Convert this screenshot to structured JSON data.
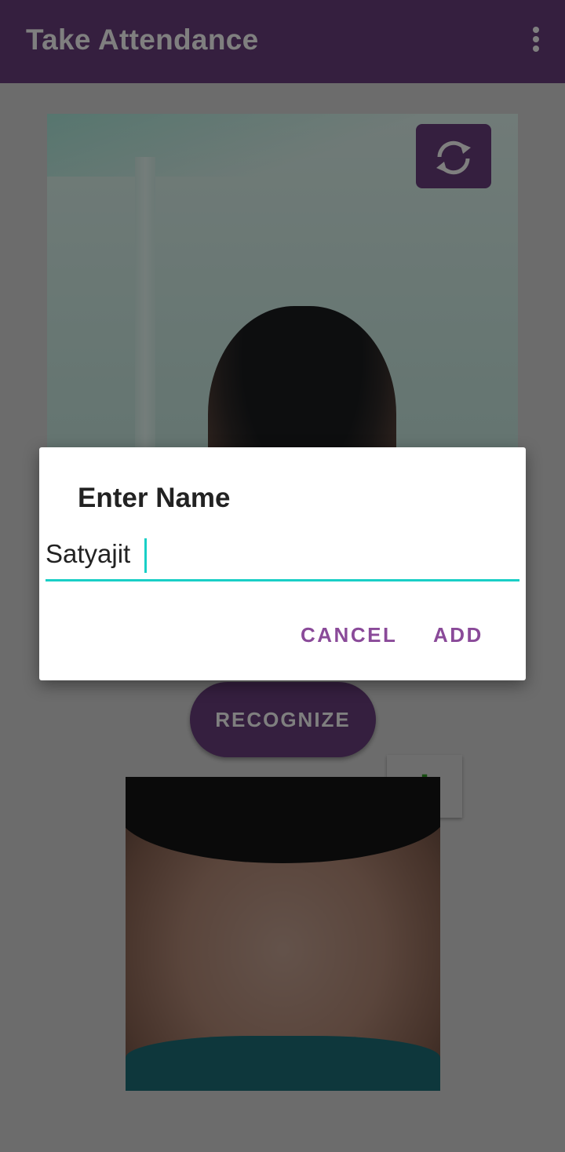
{
  "app_bar": {
    "title": "Take Attendance",
    "overflow_icon": "more-vert-icon"
  },
  "camera": {
    "switch_icon": "switch-camera-icon"
  },
  "actions": {
    "recognize_label": "RECOGNIZE",
    "add_face_label": "+"
  },
  "dialog": {
    "title": "Enter Name",
    "name_value": "Satyajit",
    "cancel_label": "CANCEL",
    "add_label": "ADD"
  },
  "colors": {
    "primary": "#6b3f7f",
    "accent_teal": "#19cfc6",
    "dialog_button": "#8a4a99",
    "add_green": "#2e9b23"
  }
}
